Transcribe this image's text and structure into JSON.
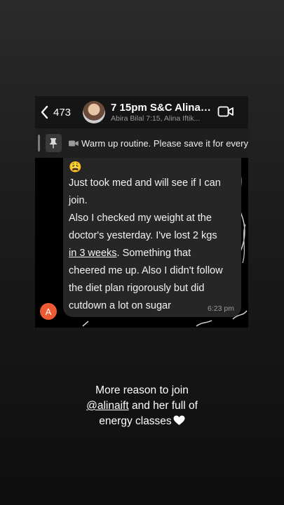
{
  "header": {
    "back_count": "473",
    "title": "7 15pm S&C Alina I...",
    "subtitle": "Abira Bilal 7:15, Alina Iftik..."
  },
  "pinned": {
    "text": "Warm up routine. Please save it for every"
  },
  "message": {
    "emoji": "😩",
    "line_1": "Just took med and will see if I can",
    "line_2": "join.",
    "line_3": "Also I checked my weight at the",
    "line_4": "doctor's yesterday. I've lost 2 kgs",
    "line_5_underlined": "in 3 weeks",
    "line_5_rest": ". Something that",
    "line_6": "cheered me up. Also I didn't follow",
    "line_7": "the diet plan rigorously but did",
    "line_8": "cutdown a lot on sugar",
    "time": "6:23 pm",
    "sender_initial": "A"
  },
  "caption": {
    "line_1": "More reason to join",
    "mention": "@alinaift",
    "line_2_rest": " and her full of",
    "line_3": "energy classes"
  },
  "colors": {
    "avatar_orange": "#ec5b34",
    "bubble": "#262626"
  },
  "icons": [
    "chevron-left-icon",
    "video-call-icon",
    "pin-icon",
    "video-camera-icon",
    "heart-icon"
  ]
}
